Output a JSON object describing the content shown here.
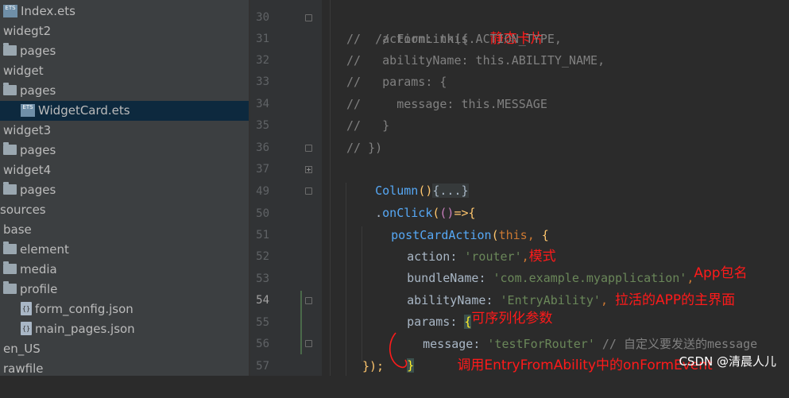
{
  "tree": {
    "rows": [
      {
        "label": "Index.ets",
        "icon": "ets-file-icon",
        "indent": 3
      },
      {
        "label": "widegt2",
        "icon": "",
        "indent": 2
      },
      {
        "label": "pages",
        "icon": "folder-icon",
        "indent": 3
      },
      {
        "label": "widget",
        "icon": "",
        "indent": 2
      },
      {
        "label": "pages",
        "icon": "folder-icon",
        "indent": 3
      },
      {
        "label": "WidgetCard.ets",
        "icon": "ets-file-icon",
        "indent": 4,
        "selected": true
      },
      {
        "label": "widget3",
        "icon": "",
        "indent": 2
      },
      {
        "label": "pages",
        "icon": "folder-icon",
        "indent": 3
      },
      {
        "label": "widget4",
        "icon": "",
        "indent": 2
      },
      {
        "label": "pages",
        "icon": "folder-icon",
        "indent": 3
      },
      {
        "label": "sources",
        "icon": "",
        "indent": 0
      },
      {
        "label": "base",
        "icon": "",
        "indent": 2
      },
      {
        "label": "element",
        "icon": "folder-icon",
        "indent": 3
      },
      {
        "label": "media",
        "icon": "folder-icon",
        "indent": 3
      },
      {
        "label": "profile",
        "icon": "folder-icon",
        "indent": 3
      },
      {
        "label": "form_config.json",
        "icon": "json-file-icon",
        "indent": 4
      },
      {
        "label": "main_pages.json",
        "icon": "json-file-icon",
        "indent": 4
      },
      {
        "label": "en_US",
        "icon": "",
        "indent": 2
      },
      {
        "label": "rawfile",
        "icon": "",
        "indent": 2
      }
    ]
  },
  "gutter": {
    "line_numbers": [
      "30",
      "31",
      "32",
      "33",
      "34",
      "35",
      "36",
      "37",
      "49",
      "50",
      "51",
      "52",
      "53",
      "54",
      "55",
      "56",
      "57"
    ],
    "current_line": "54"
  },
  "code": {
    "l30": {
      "t1": "// FormLink({",
      "ann": "静态卡片"
    },
    "l31": {
      "t1": "//   action: this.ACTION_TYPE,"
    },
    "l32": {
      "t1": "//   abilityName: this.ABILITY_NAME,"
    },
    "l33": {
      "t1": "//   params: {"
    },
    "l34": {
      "t1": "//     message: this.MESSAGE"
    },
    "l35": {
      "t1": "//   }"
    },
    "l36": {
      "t1": "// })"
    },
    "l37": {
      "fn": "Column",
      "p": "()",
      "fold": "{...}"
    },
    "l49": {
      "dot": ".",
      "fn": "onClick",
      "p1": "(",
      "p2": "()",
      "arrow": "=>",
      "brace": "{"
    },
    "l50": {
      "fn": "postCardAction",
      "p": "(",
      "kw": "this",
      ",": ", ",
      "brace": "{"
    },
    "l51": {
      "key": "action",
      ":": ": ",
      "str": "'router'",
      "c": ",",
      "ann": "模式"
    },
    "l52": {
      "key": "bundleName",
      ":": ": ",
      "str": "'com.example.myapplication'",
      "c": ",",
      "ann": "App包名"
    },
    "l53": {
      "key": "abilityName",
      ":": ": ",
      "str": "'EntryAbility'",
      "c": ", ",
      "ann": "拉活的APP的主界面"
    },
    "l54": {
      "key": "params",
      ":": ": ",
      "brace": "{",
      "ann": "可序列化参数"
    },
    "l55": {
      "key": "message",
      ":": ": ",
      "str": "'testForRouter'",
      "cm": " // 自定义要发送的message"
    },
    "l56": {
      "brace": "}",
      "ann": "调用EntryFromAbility中的onFormEvent"
    },
    "l57": {
      "t1": "});"
    }
  },
  "watermark": "CSDN @清晨人儿",
  "colors": {
    "tree_bg": "#3c3f41",
    "editor_bg": "#2b2b2b",
    "gutter_bg": "#313335",
    "selected": "#0d293e",
    "annotation": "#ff1a1a"
  }
}
